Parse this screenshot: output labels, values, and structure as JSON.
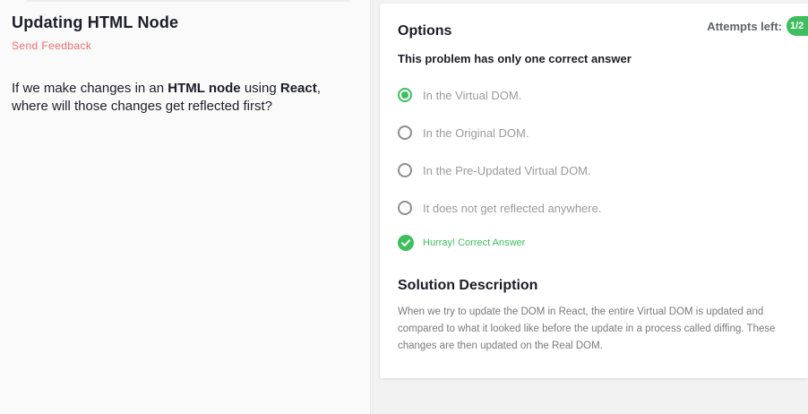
{
  "question": {
    "title": "Updating HTML Node",
    "feedback_label": "Send Feedback",
    "text_part1": "If we make changes in an ",
    "text_bold1": "HTML node",
    "text_part2": " using ",
    "text_bold2": "React",
    "text_part3": ", where will those changes get reflected first?"
  },
  "options_panel": {
    "title": "Options",
    "attempts_label": "Attempts left:",
    "attempts_value": "1/2",
    "instruction": "This problem has only one correct answer",
    "options": [
      {
        "label": "In the Virtual DOM.",
        "selected": true
      },
      {
        "label": "In the Original DOM.",
        "selected": false
      },
      {
        "label": "In the Pre-Updated Virtual DOM.",
        "selected": false
      },
      {
        "label": "It does not get reflected anywhere.",
        "selected": false
      }
    ],
    "result_text": "Hurray! Correct Answer",
    "result_icon": "check-circle-icon"
  },
  "solution": {
    "title": "Solution Description",
    "text": "When we try to update the DOM in React, the entire Virtual DOM is updated and compared to what it looked like before the update in a process called diffing. These changes are then updated on the Real DOM."
  },
  "colors": {
    "accent_green": "#3fbe5e",
    "feedback_red": "#ef6c6c",
    "muted_text": "#9b9b9b"
  }
}
